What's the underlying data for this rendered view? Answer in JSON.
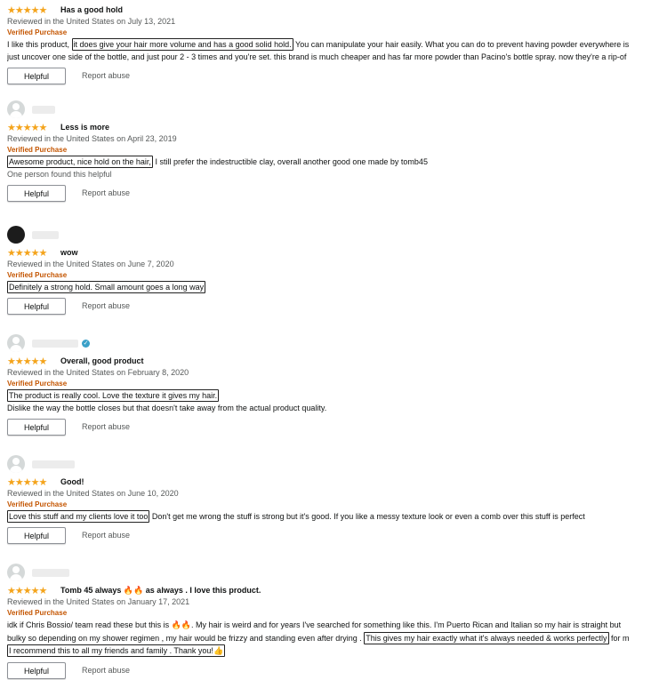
{
  "reviews": [
    {
      "title": "Has a good hold",
      "stars": "★★★★★",
      "date": "Reviewed in the United States on July 13, 2021",
      "verified": "Verified Purchase",
      "body1_pre": "I like this product, ",
      "body1_hl": "it does give your hair more volume and has a good solid hold.",
      "body1_post": " You can manipulate your hair easily. What you can do to prevent having powder everywhere is",
      "body2": "just uncover one side of the bottle, and just pour 2 - 3 times and you're set. this brand is much cheaper and has far more powder than Pacino's bottle spray. now they're a rip-of",
      "helpful": "Helpful",
      "report": "Report abuse"
    },
    {
      "title": "Less is more",
      "stars": "★★★★★",
      "date": "Reviewed in the United States on April 23, 2019",
      "verified": "Verified Purchase",
      "body_hl": "Awesome product, nice hold on the hair,",
      "body_post": " I still prefer the indestructible clay, overall another good one made by tomb45",
      "found": "One person found this helpful",
      "helpful": "Helpful",
      "report": "Report abuse"
    },
    {
      "title": "wow",
      "stars": "★★★★★",
      "date": "Reviewed in the United States on June 7, 2020",
      "verified": "Verified Purchase",
      "body_hl": "Definitely a strong hold. Small amount goes a long way",
      "helpful": "Helpful",
      "report": "Report abuse"
    },
    {
      "title": "Overall, good product",
      "stars": "★★★★★",
      "date": "Reviewed in the United States on February 8, 2020",
      "verified": "Verified Purchase",
      "body_hl": "The product is really cool. Love the texture it gives my hair.",
      "body2": "Dislike the way the bottle closes but that doesn't take away from the actual product quality.",
      "helpful": "Helpful",
      "report": "Report abuse"
    },
    {
      "title": "Good!",
      "stars": "★★★★★",
      "date": "Reviewed in the United States on June 10, 2020",
      "verified": "Verified Purchase",
      "body_hl": "Love this stuff and my clients love it too",
      "body_post": " Don't get me wrong the stuff is strong but it's good. If you like a messy texture look or even a comb over this stuff is perfect",
      "helpful": "Helpful",
      "report": "Report abuse"
    },
    {
      "title_pre": "Tomb 45 always ",
      "title_emoji": "🔥🔥",
      "title_post": " as always . I love this product.",
      "stars": "★★★★★",
      "date": "Reviewed in the United States on January 17, 2021",
      "verified": "Verified Purchase",
      "body1_pre": "idk if Chris Bossio/ team read these but this is ",
      "body1_emoji": "🔥🔥",
      "body1_post": ". My hair is weird and for years I've searched for something like this. I'm Puerto Rican and Italian so my hair is straight but",
      "body2_pre": "bulky so depending on my shower regimen , my hair would be frizzy and standing even after drying . ",
      "body2_hl": "This gives my hair exactly what it's always needed & works perfectly",
      "body2_post": " for m",
      "body3_hl": "I recommend this to all my friends and family . Thank you!",
      "body3_emoji": "👍",
      "helpful": "Helpful",
      "report": "Report abuse"
    }
  ]
}
